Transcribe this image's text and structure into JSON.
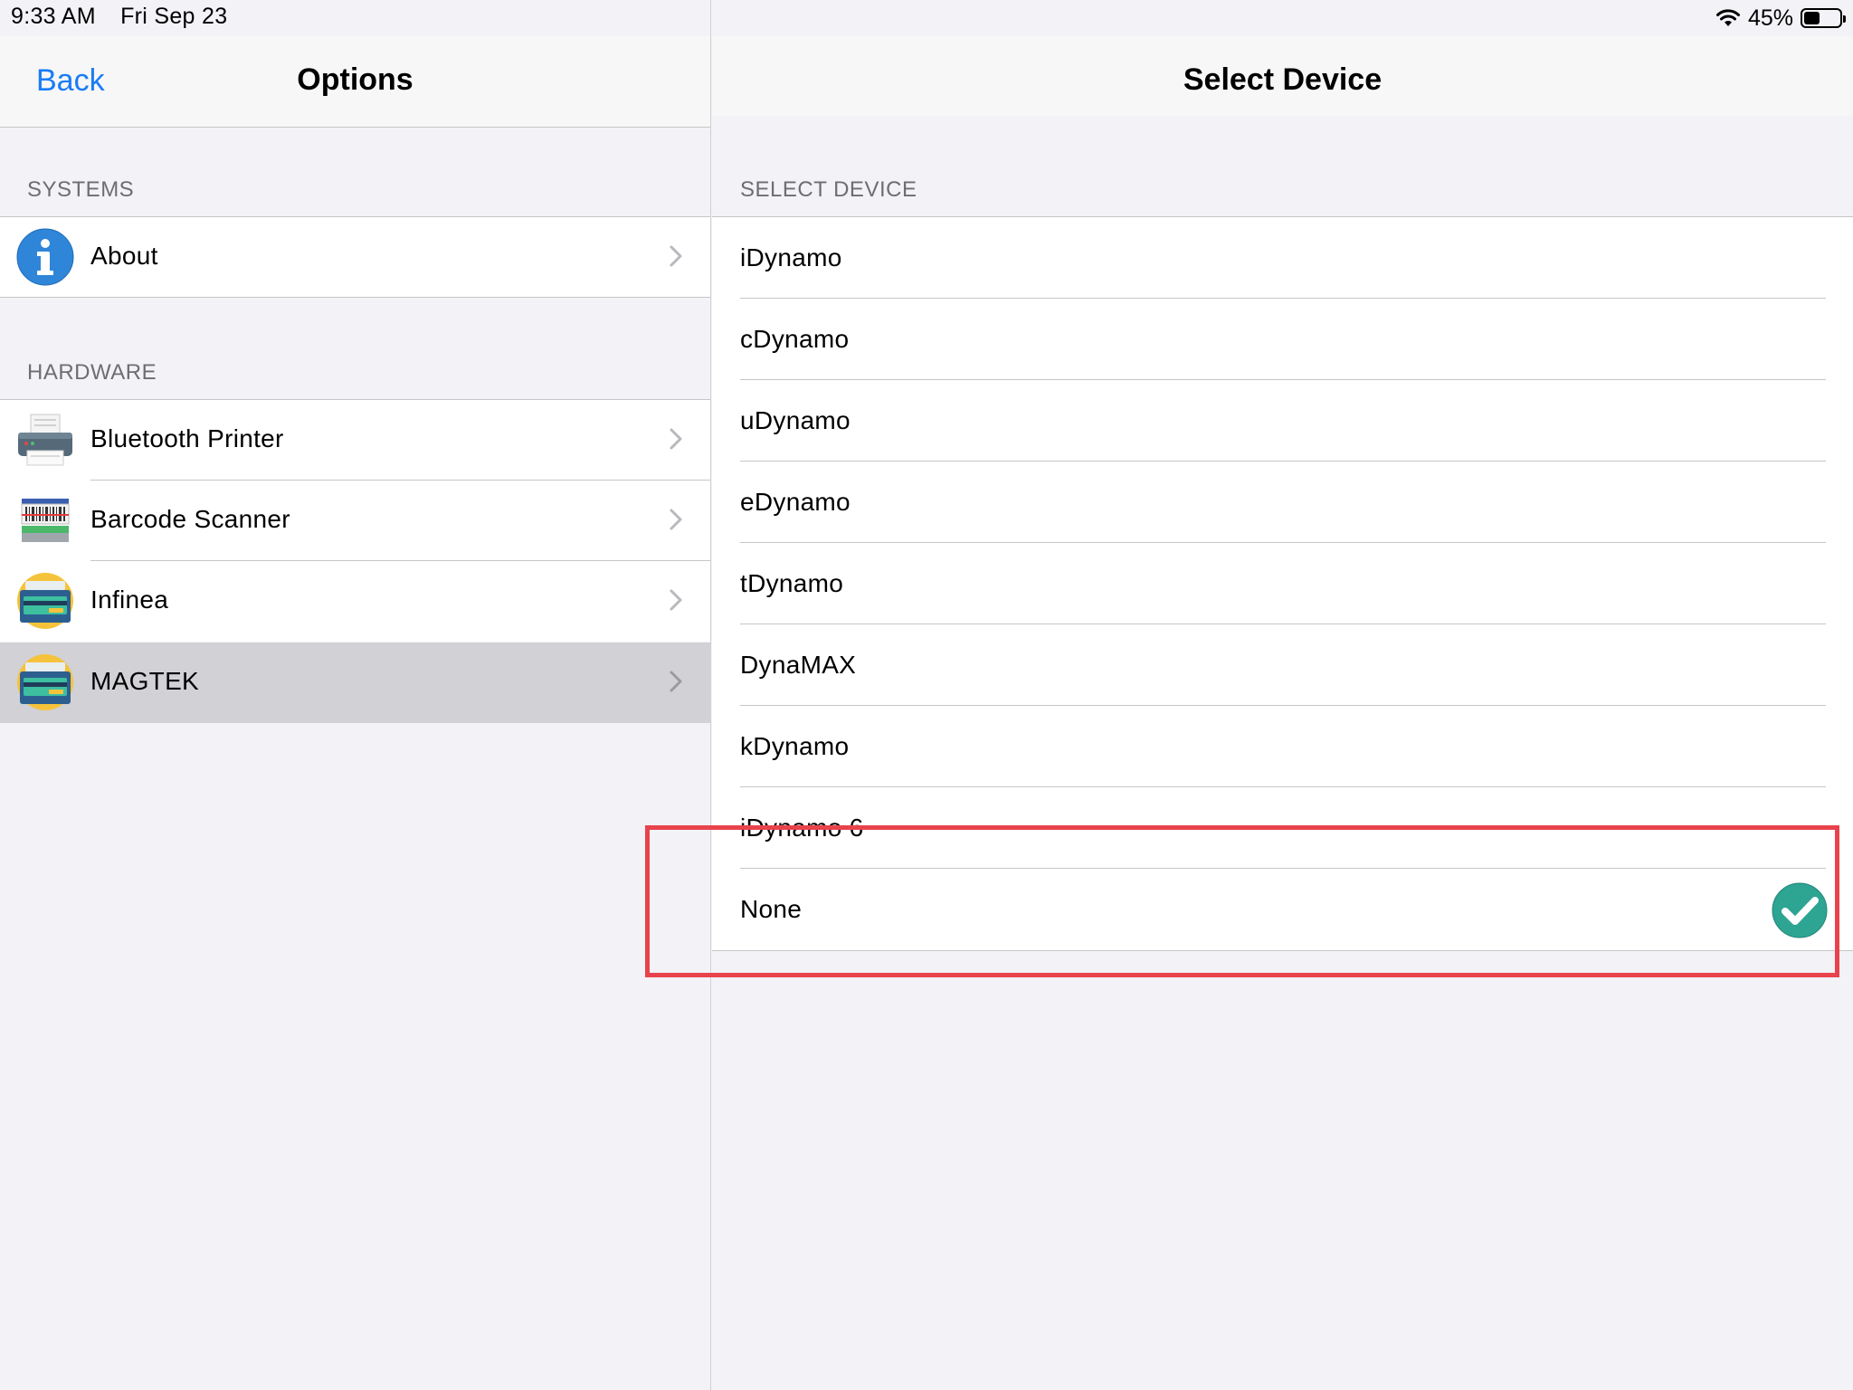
{
  "status_bar": {
    "time": "9:33 AM",
    "date": "Fri Sep 23",
    "battery_percent": "45%",
    "battery_level": 0.45,
    "icons": [
      "wifi-icon",
      "battery-icon"
    ]
  },
  "left_panel": {
    "nav": {
      "back_label": "Back",
      "title": "Options"
    },
    "sections": [
      {
        "header": "SYSTEMS",
        "items": [
          {
            "label": "About",
            "icon": "info-icon",
            "selected": false
          }
        ]
      },
      {
        "header": "HARDWARE",
        "items": [
          {
            "label": "Bluetooth Printer",
            "icon": "printer-icon",
            "selected": false
          },
          {
            "label": "Barcode Scanner",
            "icon": "barcode-scanner-icon",
            "selected": false
          },
          {
            "label": "Infinea",
            "icon": "card-reader-icon",
            "selected": false
          },
          {
            "label": "MAGTEK",
            "icon": "card-reader-icon",
            "selected": true
          }
        ]
      }
    ]
  },
  "right_panel": {
    "nav_title": "Select Device",
    "section_header": "SELECT DEVICE",
    "devices": [
      {
        "label": "iDynamo",
        "selected": false
      },
      {
        "label": "cDynamo",
        "selected": false
      },
      {
        "label": "uDynamo",
        "selected": false
      },
      {
        "label": "eDynamo",
        "selected": false
      },
      {
        "label": "tDynamo",
        "selected": false
      },
      {
        "label": "DynaMAX",
        "selected": false
      },
      {
        "label": "kDynamo",
        "selected": false
      },
      {
        "label": "iDynamo 6",
        "selected": false
      },
      {
        "label": "None",
        "selected": true
      }
    ]
  },
  "colors": {
    "accent": "#1a7cf6",
    "check": "#2ea493",
    "highlight": "#e8434c",
    "selected_row": "#d1d1d6"
  }
}
